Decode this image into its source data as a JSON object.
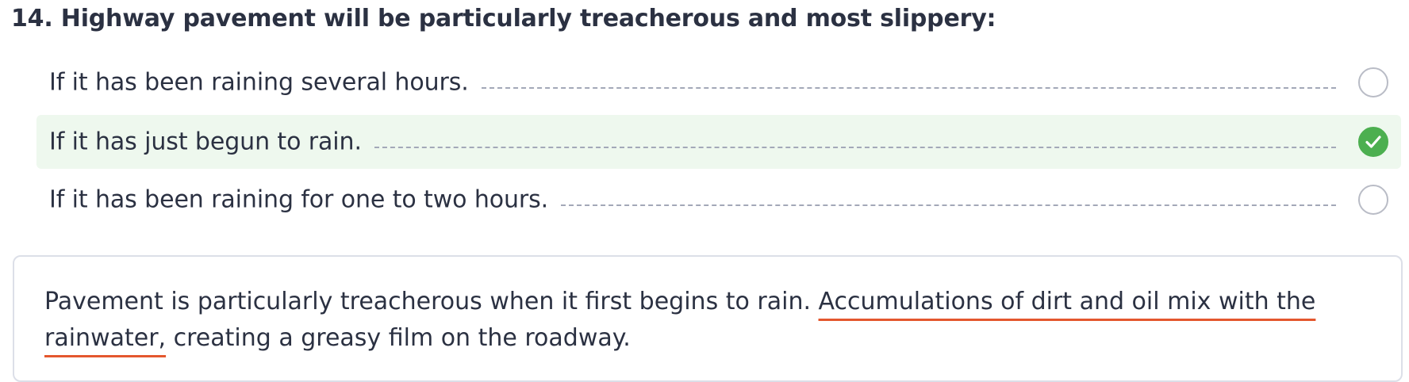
{
  "question": {
    "title": "14. Highway pavement will be particularly treacherous and most slippery:"
  },
  "options": [
    {
      "label": "If it has been raining several hours.",
      "selected": false
    },
    {
      "label": "If it has just begun to rain.",
      "selected": true
    },
    {
      "label": "If it has been raining for one to two hours.",
      "selected": false
    }
  ],
  "explanation": {
    "text_before": "Pavement is particularly treacherous when it first begins to rain. ",
    "text_highlight": "Accumulations of dirt and oil mix with the rainwater,",
    "text_after": " creating a greasy film on the roadway."
  },
  "colors": {
    "correct_bg": "#eef8ee",
    "check_green": "#4caf50",
    "highlight_underline": "#e4572e"
  },
  "icons": {
    "check": "check-icon"
  }
}
